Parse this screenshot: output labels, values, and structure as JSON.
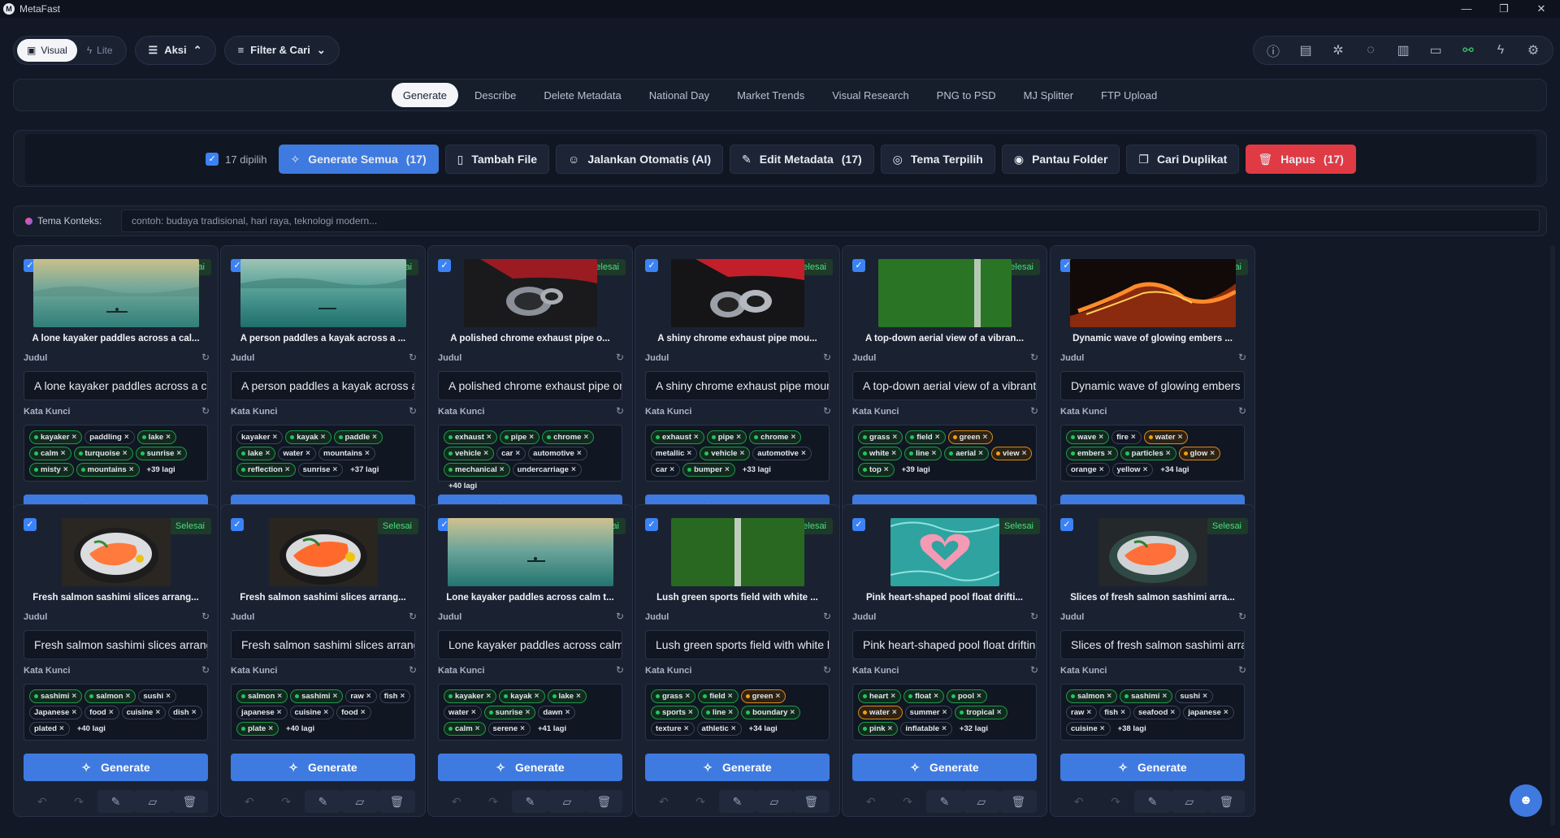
{
  "app": {
    "title": "MetaFast",
    "logo": "M"
  },
  "window_controls": {
    "minimize": "—",
    "maximize": "❐",
    "close": "✕"
  },
  "mode_toggle": {
    "visual": "Visual",
    "lite": "Lite",
    "selected": "Visual"
  },
  "menus": {
    "aksi": "Aksi",
    "filter": "Filter & Cari"
  },
  "right_toolbar_icons": [
    "info-icon",
    "document-icon",
    "bug-icon",
    "chat-icon",
    "map-icon",
    "monitor-icon",
    "link-status-icon",
    "lightning-icon",
    "gear-icon"
  ],
  "tabs": [
    {
      "label": "Generate",
      "active": true
    },
    {
      "label": "Describe"
    },
    {
      "label": "Delete Metadata"
    },
    {
      "label": "National Day"
    },
    {
      "label": "Market Trends"
    },
    {
      "label": "Visual Research"
    },
    {
      "label": "PNG to PSD"
    },
    {
      "label": "MJ Splitter"
    },
    {
      "label": "FTP Upload"
    }
  ],
  "actions": {
    "selected": "17 dipilih",
    "generate_all": "Generate Semua",
    "generate_all_count": "(17)",
    "add_file": "Tambah File",
    "auto_run": "Jalankan Otomatis (AI)",
    "edit_metadata": "Edit Metadata",
    "edit_metadata_count": "(17)",
    "theme": "Tema Terpilih",
    "watch_folder": "Pantau Folder",
    "find_duplicates": "Cari Duplikat",
    "delete": "Hapus",
    "delete_count": "(17)"
  },
  "context": {
    "label": "Tema Konteks:",
    "placeholder": "contoh: budaya tradisional, hari raya, teknologi modern..."
  },
  "labels": {
    "status": "Selesai",
    "title_field": "Judul",
    "keywords_field": "Kata Kunci",
    "generate": "Generate"
  },
  "cards": [
    {
      "caption": "A lone kayaker paddles across a cal...",
      "title": "A lone kayaker paddles across a calm turq",
      "img": "lake1",
      "keywords": [
        [
          "kayaker",
          "g"
        ],
        [
          "paddling",
          "n"
        ],
        [
          "lake",
          "g"
        ],
        [
          "calm",
          "g"
        ],
        [
          "turquoise",
          "g"
        ],
        [
          "sunrise",
          "g"
        ],
        [
          "misty",
          "g"
        ],
        [
          "mountains",
          "g"
        ]
      ],
      "more": "+39 lagi"
    },
    {
      "caption": "A person paddles a kayak across a ...",
      "title": "A person paddles a kayak across a serene",
      "img": "lake2",
      "keywords": [
        [
          "kayaker",
          "n"
        ],
        [
          "kayak",
          "g"
        ],
        [
          "paddle",
          "g"
        ],
        [
          "lake",
          "g"
        ],
        [
          "water",
          "n"
        ],
        [
          "mountains",
          "n"
        ],
        [
          "reflection",
          "g"
        ],
        [
          "sunrise",
          "n"
        ]
      ],
      "more": "+37 lagi"
    },
    {
      "caption": "A polished chrome exhaust pipe o...",
      "title": "A polished chrome exhaust pipe on a red v",
      "img": "exhaust1",
      "keywords": [
        [
          "exhaust",
          "g"
        ],
        [
          "pipe",
          "g"
        ],
        [
          "chrome",
          "g"
        ],
        [
          "vehicle",
          "g"
        ],
        [
          "car",
          "n"
        ],
        [
          "automotive",
          "n"
        ],
        [
          "mechanical",
          "g"
        ],
        [
          "undercarriage",
          "n"
        ]
      ],
      "more": "+40 lagi"
    },
    {
      "caption": "A shiny chrome exhaust pipe mou...",
      "title": "A shiny chrome exhaust pipe mounted und",
      "img": "exhaust2",
      "keywords": [
        [
          "exhaust",
          "g"
        ],
        [
          "pipe",
          "g"
        ],
        [
          "chrome",
          "g"
        ],
        [
          "metallic",
          "n"
        ],
        [
          "vehicle",
          "g"
        ],
        [
          "automotive",
          "n"
        ],
        [
          "car",
          "n"
        ],
        [
          "bumper",
          "g"
        ]
      ],
      "more": "+33 lagi"
    },
    {
      "caption": "A top-down aerial view of a vibran...",
      "title": "A top-down aerial view of a vibrant green",
      "img": "field1",
      "keywords": [
        [
          "grass",
          "g"
        ],
        [
          "field",
          "g"
        ],
        [
          "green",
          "o"
        ],
        [
          "white",
          "g"
        ],
        [
          "line",
          "g"
        ],
        [
          "aerial",
          "g"
        ],
        [
          "view",
          "o"
        ],
        [
          "top",
          "g"
        ]
      ],
      "more": "+39 lagi"
    },
    {
      "caption": "Dynamic wave of glowing embers ...",
      "title": "Dynamic wave of glowing embers and wat",
      "img": "embers",
      "keywords": [
        [
          "wave",
          "g"
        ],
        [
          "fire",
          "n"
        ],
        [
          "water",
          "o"
        ],
        [
          "embers",
          "g"
        ],
        [
          "particles",
          "g"
        ],
        [
          "glow",
          "o"
        ],
        [
          "orange",
          "n"
        ],
        [
          "yellow",
          "n"
        ]
      ],
      "more": "+34 lagi"
    },
    {
      "caption": "Fresh salmon sashimi slices arrang...",
      "title": "Fresh salmon sashimi slices arranged on a",
      "img": "sashimi1",
      "keywords": [
        [
          "sashimi",
          "g"
        ],
        [
          "salmon",
          "g"
        ],
        [
          "sushi",
          "n"
        ],
        [
          "Japanese",
          "n"
        ],
        [
          "food",
          "n"
        ],
        [
          "cuisine",
          "n"
        ],
        [
          "dish",
          "n"
        ],
        [
          "plated",
          "n"
        ]
      ],
      "more": "+40 lagi"
    },
    {
      "caption": "Fresh salmon sashimi slices arrang...",
      "title": "Fresh salmon sashimi slices arranged on cr",
      "img": "sashimi2",
      "keywords": [
        [
          "salmon",
          "g"
        ],
        [
          "sashimi",
          "g"
        ],
        [
          "raw",
          "n"
        ],
        [
          "fish",
          "n"
        ],
        [
          "japanese",
          "n"
        ],
        [
          "cuisine",
          "n"
        ],
        [
          "food",
          "n"
        ],
        [
          "plate",
          "g"
        ]
      ],
      "more": "+40 lagi"
    },
    {
      "caption": "Lone kayaker paddles across calm t...",
      "title": "Lone kayaker paddles across calm turquois",
      "img": "lake3",
      "keywords": [
        [
          "kayaker",
          "g"
        ],
        [
          "kayak",
          "g"
        ],
        [
          "lake",
          "g"
        ],
        [
          "water",
          "n"
        ],
        [
          "sunrise",
          "g"
        ],
        [
          "dawn",
          "n"
        ],
        [
          "calm",
          "g"
        ],
        [
          "serene",
          "n"
        ]
      ],
      "more": "+41 lagi"
    },
    {
      "caption": "Lush green sports field with white ...",
      "title": "Lush green sports field with white bounda",
      "img": "field2",
      "keywords": [
        [
          "grass",
          "g"
        ],
        [
          "field",
          "g"
        ],
        [
          "green",
          "o"
        ],
        [
          "sports",
          "g"
        ],
        [
          "line",
          "g"
        ],
        [
          "boundary",
          "g"
        ],
        [
          "texture",
          "n"
        ],
        [
          "athletic",
          "n"
        ]
      ],
      "more": "+34 lagi"
    },
    {
      "caption": "Pink heart-shaped pool float drifti...",
      "title": "Pink heart-shaped pool float drifting in tur",
      "img": "pool",
      "keywords": [
        [
          "heart",
          "g"
        ],
        [
          "float",
          "g"
        ],
        [
          "pool",
          "g"
        ],
        [
          "water",
          "o"
        ],
        [
          "summer",
          "n"
        ],
        [
          "tropical",
          "g"
        ],
        [
          "pink",
          "g"
        ],
        [
          "inflatable",
          "n"
        ]
      ],
      "more": "+32 lagi"
    },
    {
      "caption": "Slices of fresh salmon sashimi arra...",
      "title": "Slices of fresh salmon sashimi arranged or",
      "img": "sashimi3",
      "keywords": [
        [
          "salmon",
          "g"
        ],
        [
          "sashimi",
          "g"
        ],
        [
          "sushi",
          "n"
        ],
        [
          "raw",
          "n"
        ],
        [
          "fish",
          "n"
        ],
        [
          "seafood",
          "n"
        ],
        [
          "japanese",
          "n"
        ],
        [
          "cuisine",
          "n"
        ]
      ],
      "more": "+38 lagi"
    }
  ],
  "colors": {
    "accent": "#3f7ae0",
    "danger": "#e03a44",
    "success": "#4ade80",
    "background": "#121826"
  }
}
